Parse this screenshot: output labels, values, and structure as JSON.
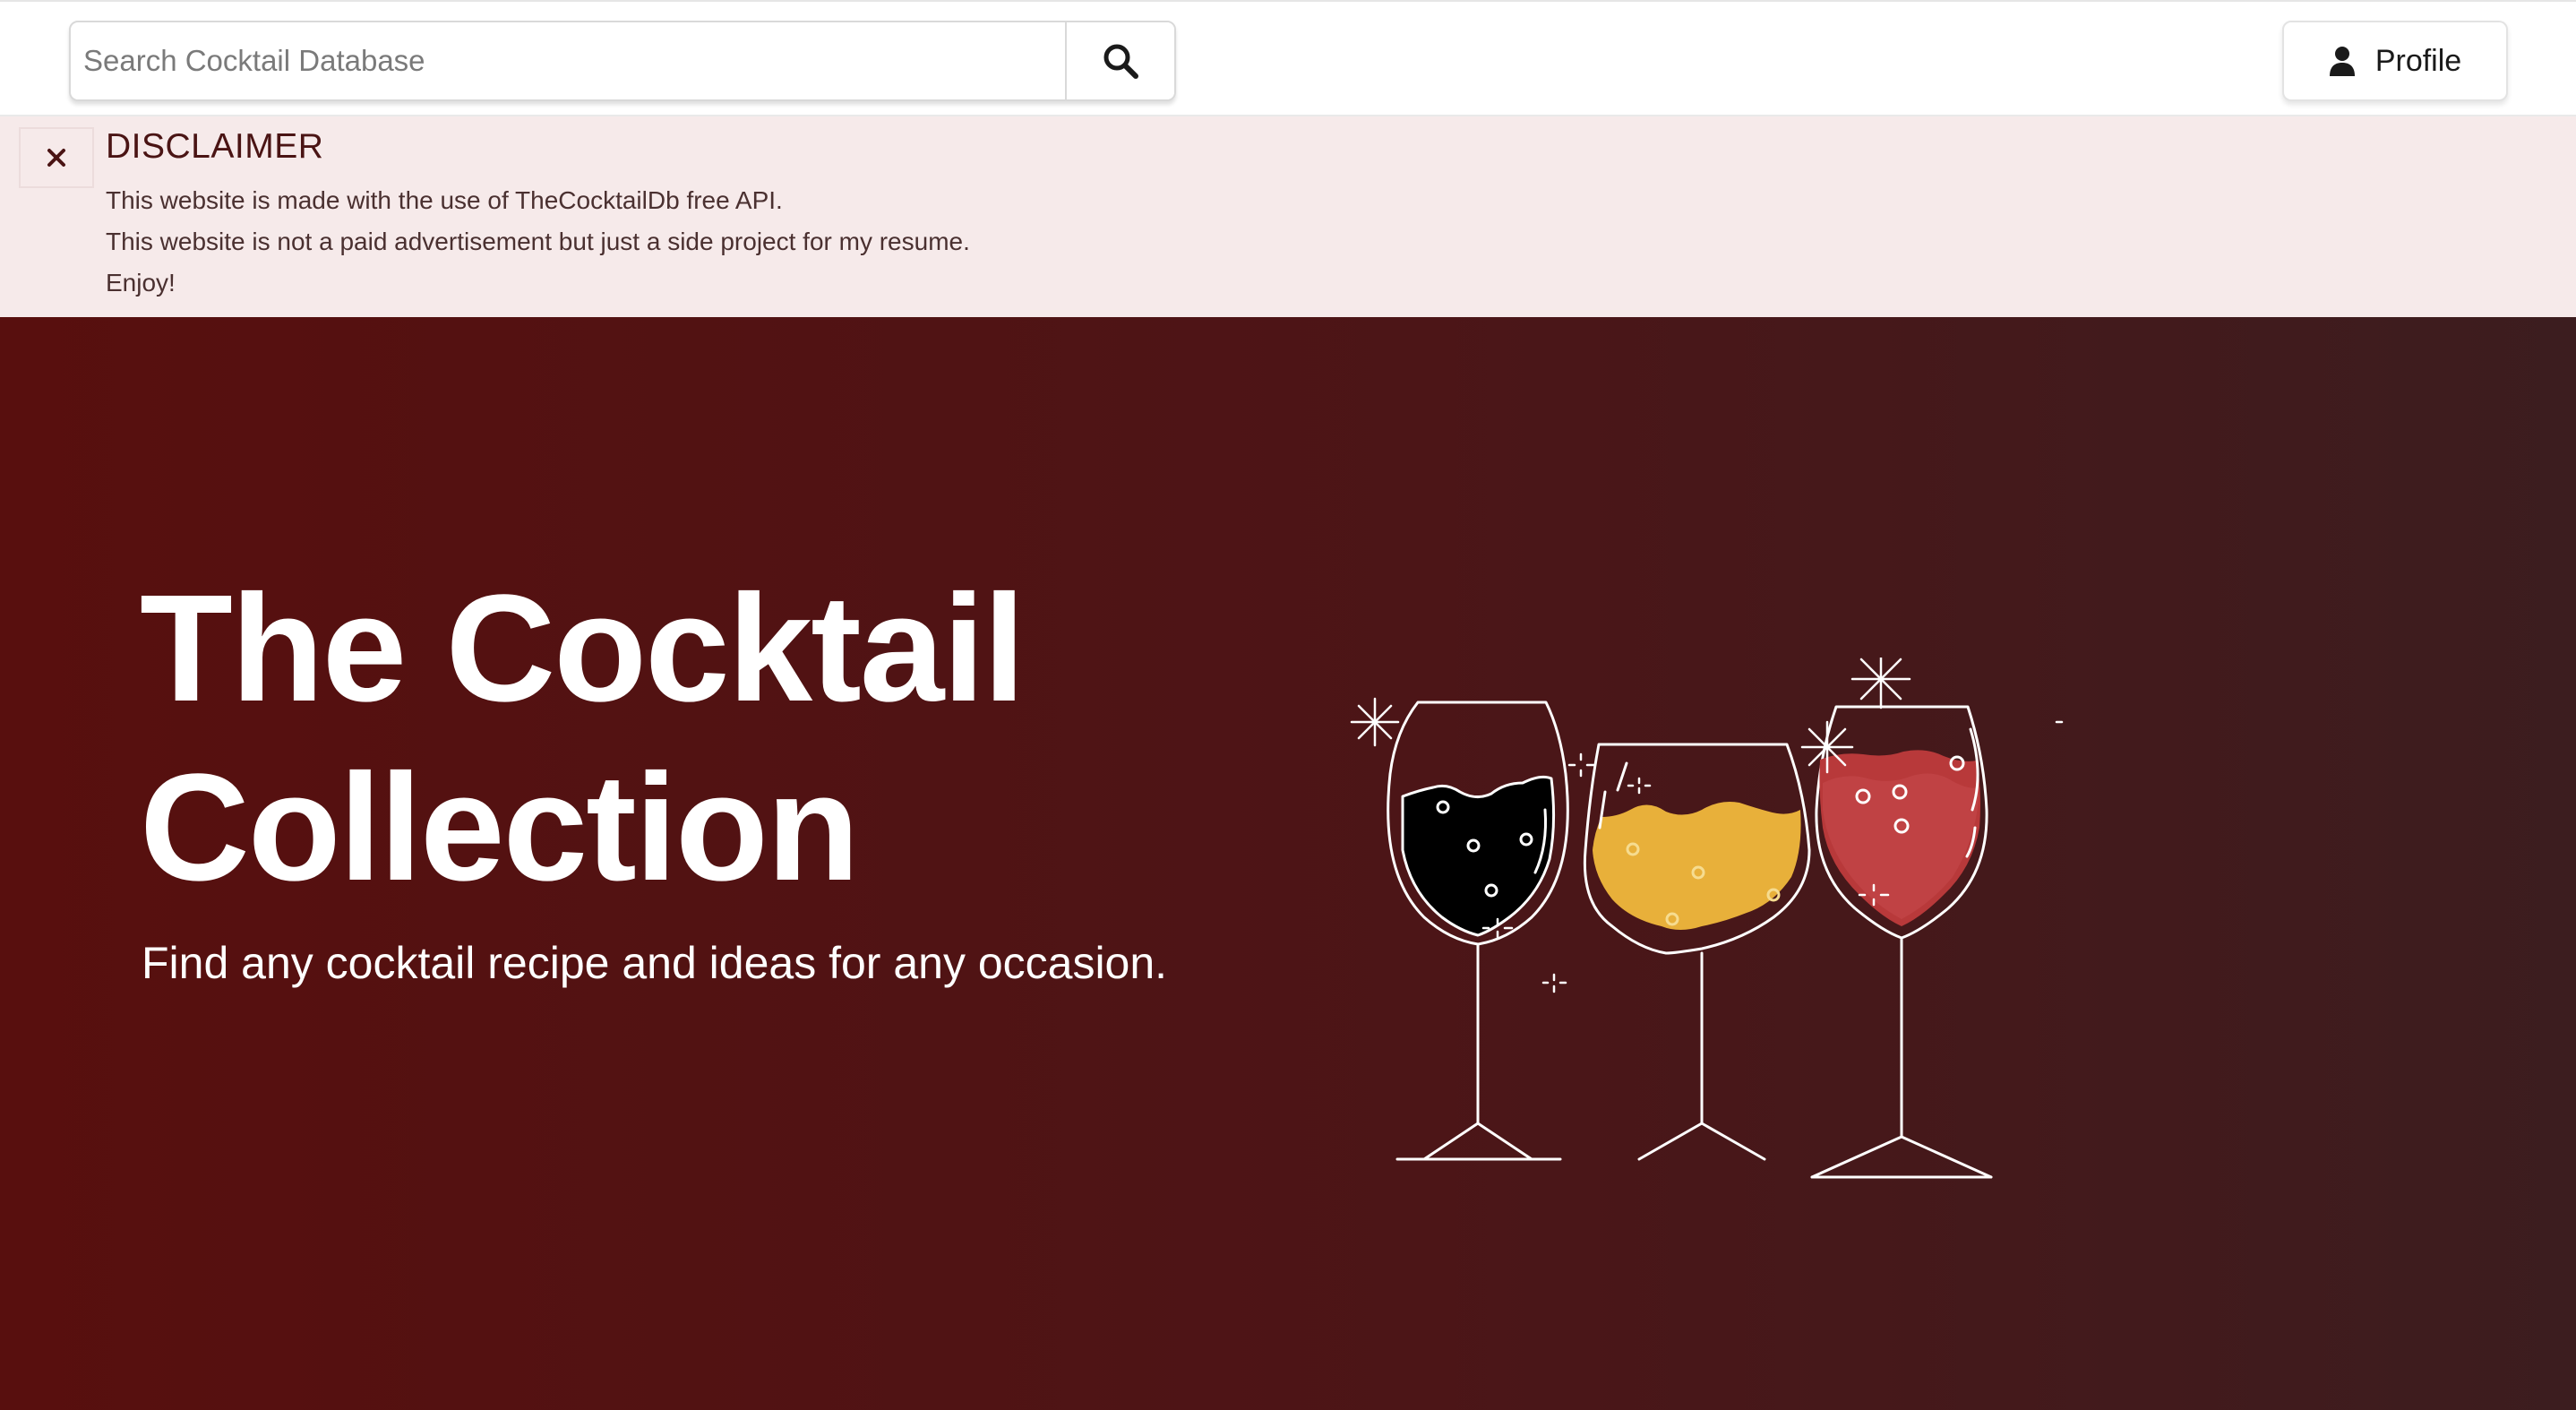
{
  "header": {
    "search_placeholder": "Search Cocktail Database",
    "search_icon": "search-icon",
    "profile_label": "Profile",
    "profile_icon": "user-icon"
  },
  "disclaimer": {
    "title": "DISCLAIMER",
    "lines": [
      "This website is made with the use of TheCocktailDb free API.",
      "This website is not a paid advertisement but just a side project for my resume.",
      "Enjoy!"
    ],
    "close_icon": "close-icon"
  },
  "hero": {
    "title": "The Cocktail Collection",
    "subtitle": "Find any cocktail recipe and ideas for any occasion.",
    "illustration": "wine-glasses-illustration"
  },
  "colors": {
    "hero_bg_left": "#580f0e",
    "hero_bg_right": "#3c1d1f",
    "disclaimer_bg": "#f6eaea",
    "drink_black": "#000000",
    "drink_yellow": "#e8b03a",
    "drink_red": "#b8393a"
  }
}
